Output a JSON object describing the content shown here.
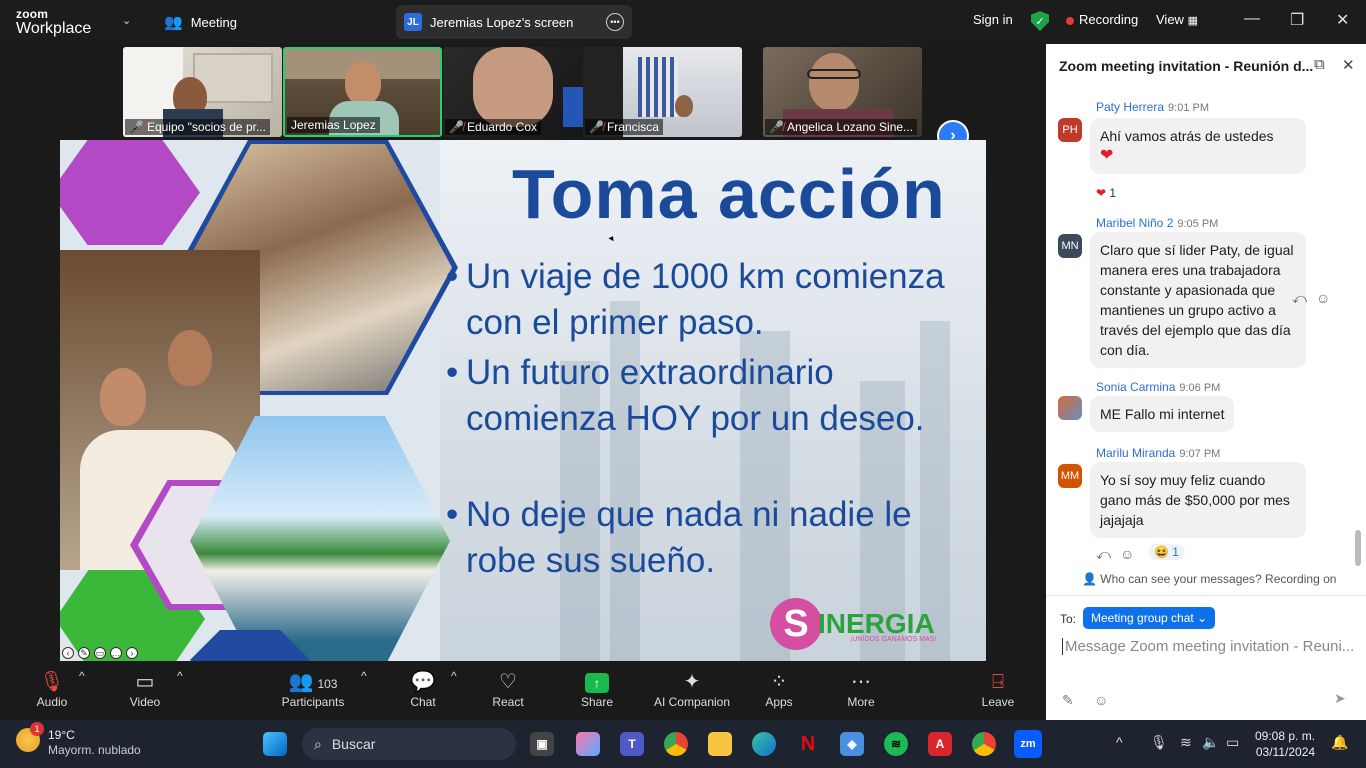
{
  "topbar": {
    "logo_line1": "zoom",
    "logo_line2": "Workplace",
    "meeting_label": "Meeting",
    "screen_badge": "JL",
    "screen_title": "Jeremias Lopez's screen",
    "sign_in": "Sign in",
    "recording": "Recording",
    "view": "View"
  },
  "participants": [
    {
      "name": "Equipo \"socios de pr...",
      "muted": true
    },
    {
      "name": "Jeremias Lopez",
      "muted": false,
      "active": true
    },
    {
      "name": "Eduardo Cox",
      "muted": true
    },
    {
      "name": "Francisca",
      "muted": true
    },
    {
      "name": "Angelica Lozano Sine...",
      "muted": true
    }
  ],
  "slide": {
    "title": "Toma acción",
    "bullets": [
      [
        "Un viaje de 1000 km comienza",
        "con el primer paso."
      ],
      [
        "Un futuro extraordinario",
        "comienza HOY por un deseo."
      ],
      [
        "No deje que nada ni nadie le",
        "robe sus sueño."
      ]
    ],
    "brand": "INERGIA",
    "brand_initial": "S",
    "brand_tagline": "¡UNIDOS GANAMOS MAS!"
  },
  "toolbar": {
    "audio": "Audio",
    "video": "Video",
    "participants": "Participants",
    "participants_count": "103",
    "chat": "Chat",
    "react": "React",
    "share": "Share",
    "ai": "AI Companion",
    "apps": "Apps",
    "more": "More",
    "leave": "Leave"
  },
  "chat_panel": {
    "title": "Zoom meeting invitation - Reunión d...",
    "messages": [
      {
        "initials": "PH",
        "color": "#c0392b",
        "sender": "Paty Herrera",
        "time": "9:01 PM",
        "text": "Ahí vamos atrás de ustedes",
        "reaction_count": "1"
      },
      {
        "initials": "MN",
        "color": "#3d4a5c",
        "sender": "Maribel Niño 2",
        "time": "9:05 PM",
        "text": "Claro que sí lider Paty, de igual manera eres una trabajadora constante y apasionada que mantienes un grupo activo a través del ejemplo que das día con día."
      },
      {
        "initials": "",
        "color": "#b06a3b",
        "sender": "Sonia Carmina",
        "time": "9:06 PM",
        "text": "ME Fallo mi internet"
      },
      {
        "initials": "MM",
        "color": "#d35400",
        "sender": "Marilu Miranda",
        "time": "9:07 PM",
        "text": "Yo sí soy muy feliz cuando gano más de $50,000 por mes jajajaja",
        "reaction_count": "1"
      }
    ],
    "privacy_note": "Who can see your messages? Recording on",
    "to_label": "To:",
    "to_value": "Meeting group chat",
    "input_placeholder": "Message Zoom meeting invitation - Reuni..."
  },
  "taskbar": {
    "temp": "19°C",
    "weather": "Mayorm. nublado",
    "weather_badge": "1",
    "search": "Buscar",
    "time": "09:08 p. m.",
    "date": "03/11/2024"
  }
}
